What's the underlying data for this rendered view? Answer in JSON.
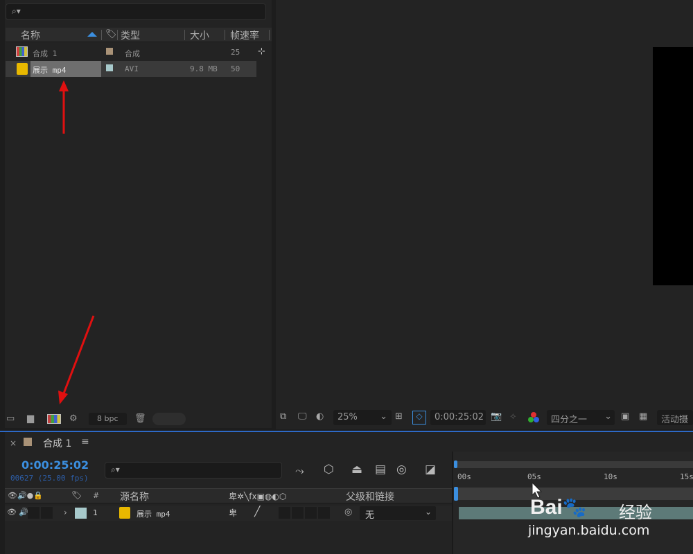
{
  "project": {
    "columns": {
      "name": "名称",
      "type": "类型",
      "size": "大小",
      "fps": "帧速率"
    },
    "items": [
      {
        "name": "合成 1",
        "type": "合成",
        "size": "",
        "fps": "25",
        "swatch": "#a99277"
      },
      {
        "name": "展示 mp4",
        "type": "AVI",
        "size": "9.8 MB",
        "fps": "50",
        "swatch": "#a7c9cb"
      }
    ],
    "bpc": "8 bpc"
  },
  "viewer": {
    "zoom": "25%",
    "timecode": "0:00:25:02",
    "resolution": "四分之一",
    "camera": "活动摄"
  },
  "timeline": {
    "tab_label": "合成 1",
    "timecode": "0:00:25:02",
    "frames_fps": "00627 (25.00 fps)",
    "headers": {
      "num": "#",
      "source_name": "源名称",
      "parent": "父级和链接"
    },
    "layers": [
      {
        "num": "1",
        "name": "展示 mp4",
        "parent": "无",
        "label_color": "#a7c9cb"
      }
    ],
    "ruler": [
      "00s",
      "05s",
      "10s",
      "15s"
    ]
  },
  "watermark": {
    "logo": "Bai",
    "logo_suffix": "经验",
    "url": "jingyan.baidu.com"
  },
  "colors": {
    "accent": "#2d69c6",
    "arrow": "#e01010"
  }
}
